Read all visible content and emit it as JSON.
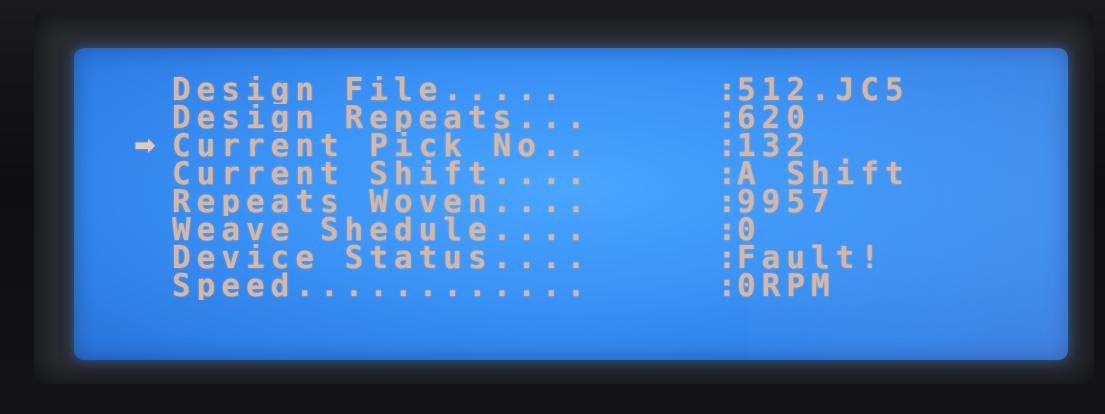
{
  "display": {
    "cursor_glyph": "➡",
    "separator": ":",
    "rows": [
      {
        "label": "Design File.....",
        "value": "512.JC5"
      },
      {
        "label": "Design Repeats...",
        "value": "620"
      },
      {
        "label": "Current Pick No..",
        "value": "132"
      },
      {
        "label": "Current Shift....",
        "value": "A Shift"
      },
      {
        "label": "Repeats Woven....",
        "value": "9957"
      },
      {
        "label": "Weave Shedule....",
        "value": "0"
      },
      {
        "label": "Device Status....",
        "value": "Fault!"
      },
      {
        "label": "Speed............",
        "value": "0RPM"
      }
    ],
    "selected_row": "Current Pick No..",
    "colors": {
      "lcd_background": "#3a92f6",
      "text": "#d9b6a0"
    }
  }
}
